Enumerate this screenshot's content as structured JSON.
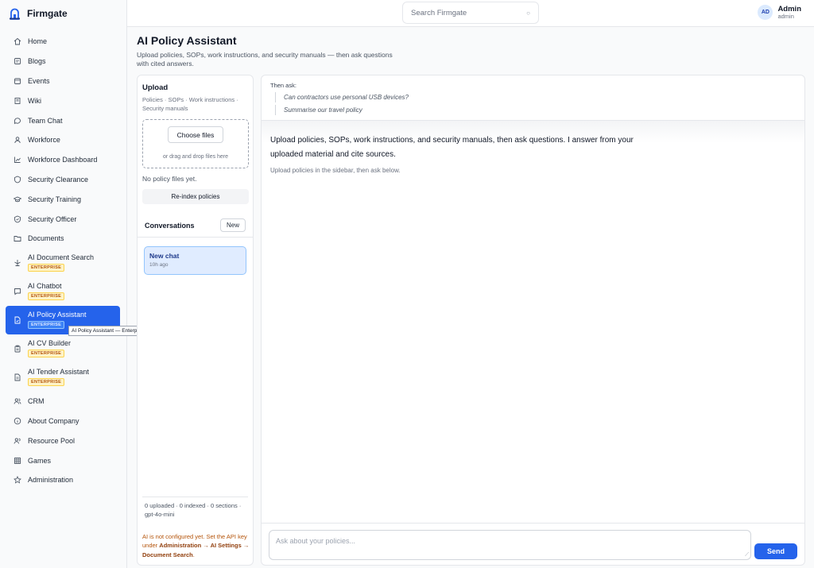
{
  "app": {
    "name": "Firmgate"
  },
  "search": {
    "placeholder": "Search Firmgate"
  },
  "user": {
    "initials": "AD",
    "name": "Admin",
    "role": "admin"
  },
  "sidebar": {
    "items": [
      {
        "label": "Home",
        "icon": "home-icon"
      },
      {
        "label": "Blogs",
        "icon": "blog-icon"
      },
      {
        "label": "Events",
        "icon": "calendar-icon"
      },
      {
        "label": "Wiki",
        "icon": "book-icon"
      },
      {
        "label": "Team Chat",
        "icon": "chat-bubble-icon"
      },
      {
        "label": "Workforce",
        "icon": "user-icon"
      },
      {
        "label": "Workforce Dashboard",
        "icon": "chart-icon"
      },
      {
        "label": "Security Clearance",
        "icon": "shield-icon"
      },
      {
        "label": "Security Training",
        "icon": "graduation-cap-icon"
      },
      {
        "label": "Security Officer",
        "icon": "shield-check-icon"
      },
      {
        "label": "Documents",
        "icon": "folder-icon"
      },
      {
        "label": "AI Document Search",
        "icon": "ai-search-icon",
        "badge": "ENTERPRISE"
      },
      {
        "label": "AI Chatbot",
        "icon": "chatbot-icon",
        "badge": "ENTERPRISE"
      },
      {
        "label": "AI Policy Assistant",
        "icon": "policy-document-icon",
        "badge": "ENTERPRISE",
        "active": true
      },
      {
        "label": "AI CV Builder",
        "icon": "clipboard-icon",
        "badge": "ENTERPRISE"
      },
      {
        "label": "AI Tender Assistant",
        "icon": "document-icon",
        "badge": "ENTERPRISE"
      },
      {
        "label": "CRM",
        "icon": "users-icon"
      },
      {
        "label": "About Company",
        "icon": "info-icon"
      },
      {
        "label": "Resource Pool",
        "icon": "people-icon"
      },
      {
        "label": "Games",
        "icon": "grid-icon"
      },
      {
        "label": "Administration",
        "icon": "star-icon"
      }
    ],
    "tooltip": "AI Policy Assistant — Enterprise feature"
  },
  "page": {
    "title": "AI Policy Assistant",
    "subtitle": "Upload policies, SOPs, work instructions, and security manuals — then ask questions with cited answers."
  },
  "upload": {
    "title": "Upload",
    "types": "Policies · SOPs · Work instructions · Security manuals",
    "choose_label": "Choose files",
    "drop_hint": "or drag and drop files here",
    "no_files": "No policy files yet.",
    "reindex_label": "Re-index policies"
  },
  "conversations": {
    "title": "Conversations",
    "new_label": "New",
    "items": [
      {
        "name": "New chat",
        "time": "10h ago"
      }
    ]
  },
  "stats": "0 uploaded · 0 indexed · 0 sections · gpt-4o-mini",
  "warning": {
    "prefix": "AI is not configured yet. Set the API key under ",
    "link": "Administration → AI Settings → Document Search",
    "suffix": "."
  },
  "chat": {
    "then_ask": "Then ask:",
    "examples": [
      "Can contractors use personal USB devices?",
      "Summarise our travel policy"
    ],
    "intro": "Upload policies, SOPs, work instructions, and security manuals, then ask questions. I answer from your uploaded material and cite sources.",
    "hint": "Upload policies in the sidebar, then ask below.",
    "input_placeholder": "Ask about your policies...",
    "send_label": "Send"
  },
  "colors": {
    "accent": "#2563eb",
    "badge": "#b45309",
    "warning": "#b45309"
  }
}
